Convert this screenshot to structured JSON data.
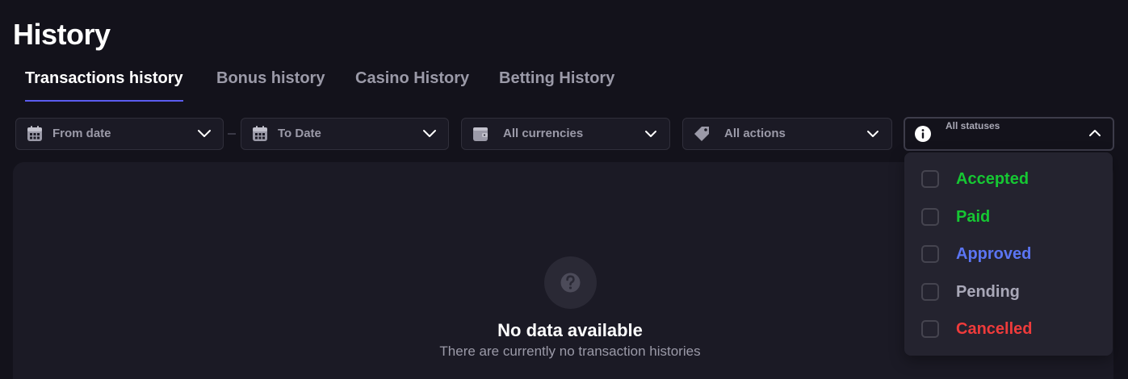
{
  "header": {
    "title": "History"
  },
  "tabs": [
    {
      "label": "Transactions history",
      "active": true
    },
    {
      "label": "Bonus history",
      "active": false
    },
    {
      "label": "Casino History",
      "active": false
    },
    {
      "label": "Betting History",
      "active": false
    }
  ],
  "filters": {
    "from_date": {
      "label": "From date",
      "icon": "calendar-icon"
    },
    "to_date": {
      "label": "To Date",
      "icon": "calendar-icon"
    },
    "currency": {
      "label": "All currencies",
      "icon": "wallet-icon"
    },
    "actions": {
      "label": "All actions",
      "icon": "tag-icon"
    },
    "status": {
      "label": "All statuses",
      "icon": "info-icon",
      "open": true
    }
  },
  "status_options": [
    {
      "label": "Accepted",
      "color": "#16c733",
      "checked": false
    },
    {
      "label": "Paid",
      "color": "#16c733",
      "checked": false
    },
    {
      "label": "Approved",
      "color": "#5b75f3",
      "checked": false
    },
    {
      "label": "Pending",
      "color": "#a9a8b8",
      "checked": false
    },
    {
      "label": "Cancelled",
      "color": "#ef3b3b",
      "checked": false
    }
  ],
  "empty_state": {
    "title": "No data available",
    "subtitle": "There are currently no transaction histories",
    "icon": "question-icon"
  },
  "colors": {
    "background": "#13121b",
    "surface": "#1b1a25",
    "accent": "#5b5cf0",
    "muted_text": "#9b9aa8"
  }
}
